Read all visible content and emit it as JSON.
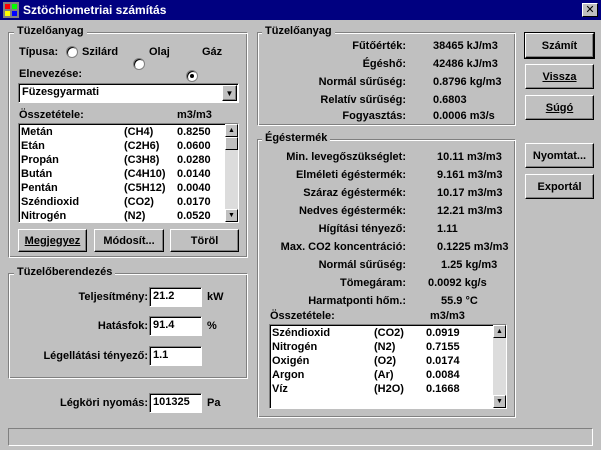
{
  "window": {
    "title": "Sztöchiometriai számítás",
    "close_glyph": "✕"
  },
  "fuel_group": {
    "title": "Tüzelőanyag",
    "type_label": "Típusa:",
    "type_options": [
      "Szilárd",
      "Olaj",
      "Gáz"
    ],
    "type_selected": "Gáz",
    "name_label": "Elnevezése:",
    "name_value": "Füzesgyarmati",
    "composition_label": "Összetétele:",
    "composition_unit": "m3/m3",
    "composition": [
      {
        "name": "Metán",
        "formula": "(CH4)",
        "value": "0.8250"
      },
      {
        "name": "Etán",
        "formula": "(C2H6)",
        "value": "0.0600"
      },
      {
        "name": "Propán",
        "formula": "(C3H8)",
        "value": "0.0280"
      },
      {
        "name": "Bután",
        "formula": "(C4H10)",
        "value": "0.0140"
      },
      {
        "name": "Pentán",
        "formula": "(C5H12)",
        "value": "0.0040"
      },
      {
        "name": "Széndioxid",
        "formula": "(CO2)",
        "value": "0.0170"
      },
      {
        "name": "Nitrogén",
        "formula": "(N2)",
        "value": "0.0520"
      }
    ],
    "buttons": {
      "note": "Megjegyez",
      "modify": "Módosít...",
      "delete": "Töröl"
    }
  },
  "device_group": {
    "title": "Tüzelőberendezés",
    "power_label": "Teljesítmény:",
    "power_value": "21.2",
    "power_unit": "kW",
    "efficiency_label": "Hatásfok:",
    "efficiency_value": "91.4",
    "efficiency_unit": "%",
    "air_factor_label": "Légellátási tényező:",
    "air_factor_value": "1.1"
  },
  "pressure": {
    "label": "Légköri nyomás:",
    "value": "101325",
    "unit": "Pa"
  },
  "fuel_props": {
    "title": "Tüzelőanyag",
    "rows": [
      {
        "label": "Fűtőérték:",
        "value": "38465 kJ/m3"
      },
      {
        "label": "Égéshő:",
        "value": "42486 kJ/m3"
      },
      {
        "label": "Normál sűrűség:",
        "value": "0.8796 kg/m3"
      },
      {
        "label": "Relatív sűrűség:",
        "value": "0.6803"
      },
      {
        "label": "Fogyasztás:",
        "value": "0.0006 m3/s"
      }
    ]
  },
  "flue_gas": {
    "title": "Égéstermék",
    "rows": [
      {
        "label": "Min. levegőszükséglet:",
        "value": "10.11 m3/m3"
      },
      {
        "label": "Elméleti égéstermék:",
        "value": "9.161 m3/m3"
      },
      {
        "label": "Száraz égéstermék:",
        "value": "10.17 m3/m3"
      },
      {
        "label": "Nedves égéstermék:",
        "value": "12.21 m3/m3"
      },
      {
        "label": "Hígítási tényező:",
        "value": "1.11"
      },
      {
        "label": "Max. CO2 koncentráció:",
        "value": "0.1225 m3/m3"
      },
      {
        "label": "Normál sűrűség:",
        "value": "1.25 kg/m3"
      },
      {
        "label": "Tömegáram:",
        "value": "0.0092 kg/s"
      },
      {
        "label": "Harmatponti hőm.:",
        "value": "55.9 °C"
      }
    ],
    "composition_label": "Összetétele:",
    "composition_unit": "m3/m3",
    "composition": [
      {
        "name": "Széndioxid",
        "formula": "(CO2)",
        "value": "0.0919"
      },
      {
        "name": "Nitrogén",
        "formula": "(N2)",
        "value": "0.7155"
      },
      {
        "name": "Oxigén",
        "formula": "(O2)",
        "value": "0.0174"
      },
      {
        "name": "Argon",
        "formula": "(Ar)",
        "value": "0.0084"
      },
      {
        "name": "Víz",
        "formula": "(H2O)",
        "value": "0.1668"
      }
    ]
  },
  "side_buttons": {
    "calculate": "Számít",
    "back": "Vissza",
    "help": "Súgó",
    "print": "Nyomtat...",
    "export": "Exportál"
  },
  "status_text": ""
}
